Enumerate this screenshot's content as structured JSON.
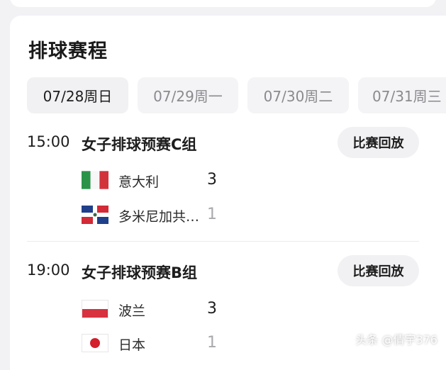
{
  "section": {
    "title": "排球赛程"
  },
  "dates": [
    {
      "label": "07/28周日",
      "active": true
    },
    {
      "label": "07/29周一",
      "active": false
    },
    {
      "label": "07/30周二",
      "active": false
    },
    {
      "label": "07/31周三",
      "active": false
    }
  ],
  "matches": [
    {
      "time": "15:00",
      "title": "女子排球预赛C组",
      "replay_label": "比赛回放",
      "teams": [
        {
          "name": "意大利",
          "score": "3",
          "flag": "italy-flag"
        },
        {
          "name": "多米尼加共…",
          "score": "1",
          "flag": "dominican-republic-flag"
        }
      ]
    },
    {
      "time": "19:00",
      "title": "女子排球预赛B组",
      "replay_label": "比赛回放",
      "teams": [
        {
          "name": "波兰",
          "score": "3",
          "flag": "poland-flag"
        },
        {
          "name": "日本",
          "score": "1",
          "flag": "japan-flag"
        }
      ]
    }
  ],
  "watermark": "头条 @倩宇376",
  "colors": {
    "background": "#f2f2f5",
    "card": "#ffffff",
    "tab_bg": "#f4f4f6",
    "muted": "#a8a8ad"
  }
}
